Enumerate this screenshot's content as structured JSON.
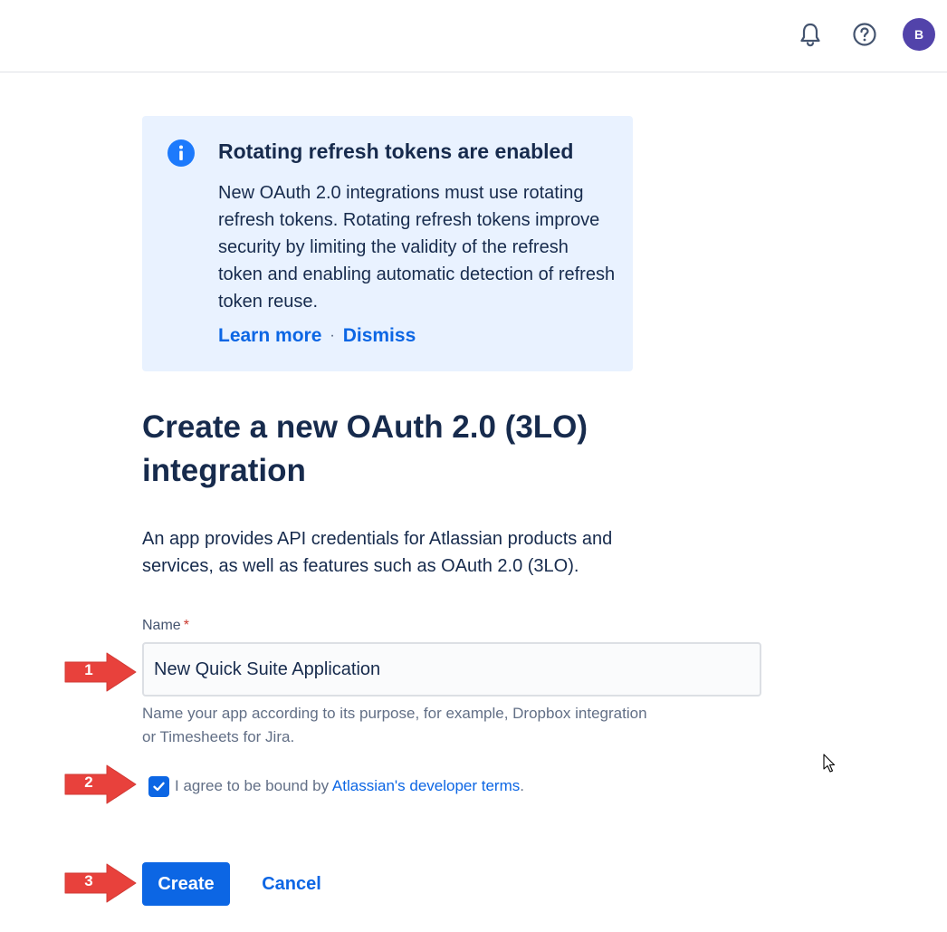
{
  "header": {
    "bell_icon": "bell-icon",
    "help_icon": "question-circle-icon",
    "avatar_initial": "B",
    "avatar_color": "#5243aa"
  },
  "banner": {
    "icon": "info-icon",
    "title": "Rotating refresh tokens are enabled",
    "body": "New OAuth 2.0 integrations must use rotating refresh tokens. Rotating refresh tokens improve security by limiting the validity of the refresh token and enabling automatic detection of refresh token reuse.",
    "learn_more": "Learn more",
    "separator": "·",
    "dismiss": "Dismiss"
  },
  "form": {
    "heading": "Create a new OAuth 2.0 (3LO) integration",
    "description": "An app provides API credentials for Atlassian products and services, as well as features such as OAuth 2.0 (3LO).",
    "name_label": "Name",
    "required_marker": "*",
    "name_value": "New Quick Suite Application",
    "name_helper": "Name your app according to its purpose, for example, Dropbox integration or Timesheets for Jira.",
    "agree_checked": true,
    "agree_text": "I agree to be bound by ",
    "agree_link": "Atlassian's developer terms",
    "agree_suffix": ".",
    "create_label": "Create",
    "cancel_label": "Cancel"
  },
  "annotations": {
    "step1": "1",
    "step2": "2",
    "step3": "3",
    "arrow_color": "#e8413c"
  },
  "colors": {
    "primary": "#0c66e4",
    "banner_bg": "#e9f2ff",
    "text": "#172b4d"
  }
}
